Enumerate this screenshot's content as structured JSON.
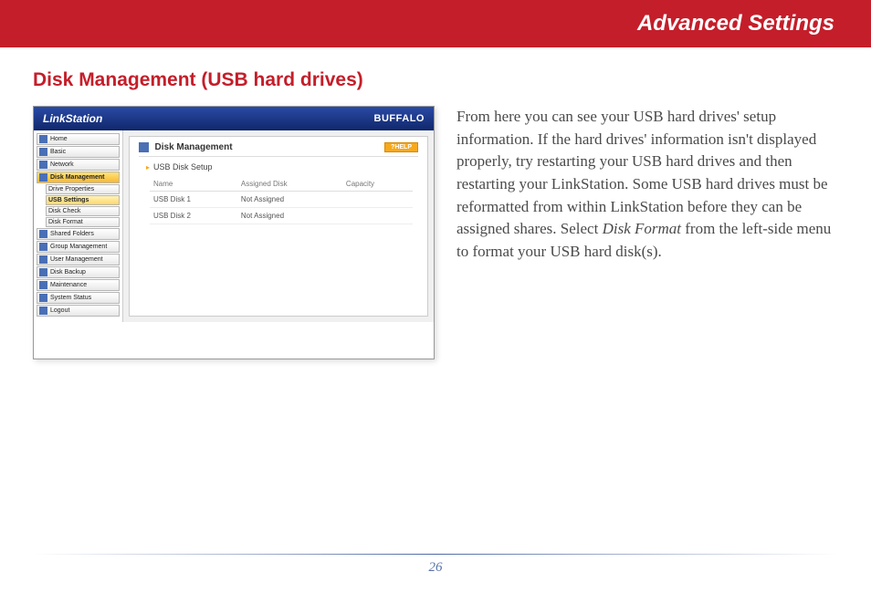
{
  "header": {
    "title": "Advanced Settings"
  },
  "section": {
    "title": "Disk Management (USB hard drives)"
  },
  "screenshot": {
    "brand_left": "LinkStation",
    "brand_right": "BUFFALO",
    "sidebar": [
      {
        "label": "Home",
        "active": false,
        "sub": false
      },
      {
        "label": "Basic",
        "active": false,
        "sub": false
      },
      {
        "label": "Network",
        "active": false,
        "sub": false
      },
      {
        "label": "Disk Management",
        "active": true,
        "sub": false
      },
      {
        "label": "Drive Properties",
        "active": false,
        "sub": true
      },
      {
        "label": "USB Settings",
        "active": true,
        "sub": true
      },
      {
        "label": "Disk Check",
        "active": false,
        "sub": true
      },
      {
        "label": "Disk Format",
        "active": false,
        "sub": true
      },
      {
        "label": "Shared Folders",
        "active": false,
        "sub": false
      },
      {
        "label": "Group Management",
        "active": false,
        "sub": false
      },
      {
        "label": "User Management",
        "active": false,
        "sub": false
      },
      {
        "label": "Disk Backup",
        "active": false,
        "sub": false
      },
      {
        "label": "Maintenance",
        "active": false,
        "sub": false
      },
      {
        "label": "System Status",
        "active": false,
        "sub": false
      },
      {
        "label": "Logout",
        "active": false,
        "sub": false
      }
    ],
    "panel": {
      "title": "Disk Management",
      "help": "?HELP",
      "subtitle": "USB Disk Setup",
      "columns": [
        "Name",
        "Assigned Disk",
        "Capacity"
      ],
      "rows": [
        {
          "name": "USB Disk 1",
          "assigned": "Not Assigned",
          "capacity": ""
        },
        {
          "name": "USB Disk 2",
          "assigned": "Not Assigned",
          "capacity": ""
        }
      ]
    }
  },
  "description": {
    "p1a": "From here you can see your USB hard drives' setup information.  If the hard drives' information isn't displayed properly, try restarting your USB hard drives and then restarting your LinkStation.  Some USB hard drives must be reformatted from within LinkStation before they can be assigned shares.  Select ",
    "p1b": "Disk Format",
    "p1c": " from the left-side menu to format your USB hard disk(s)."
  },
  "footer": {
    "page": "26"
  }
}
